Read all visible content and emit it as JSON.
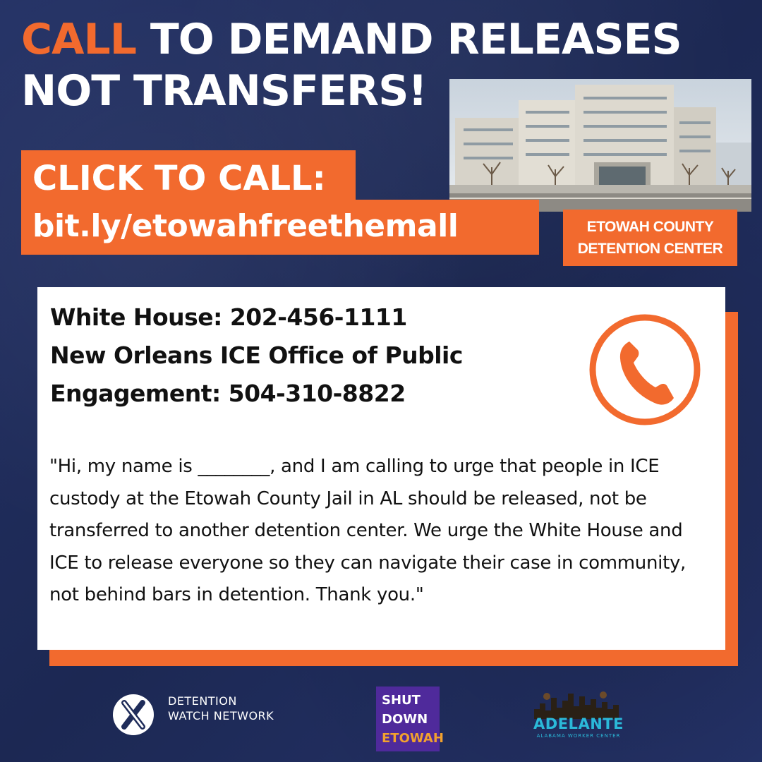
{
  "headline": {
    "line1_accent": "CALL",
    "line1_rest": " TO DEMAND RELEASES",
    "line2": "NOT TRANSFERS!"
  },
  "cta": {
    "label": "CLICK TO CALL:",
    "link": "bit.ly/etowahfreethemall"
  },
  "photo": {
    "caption_line1": "ETOWAH COUNTY",
    "caption_line2": "DETENTION CENTER"
  },
  "contacts": {
    "line1": "White House: 202-456-1111",
    "line2": "New Orleans ICE Office of Public",
    "line3": "Engagement: 504-310-8822",
    "icon": "phone-icon"
  },
  "script": {
    "text": "\"Hi, my name is ________, and I am calling to urge that people in ICE custody at the Etowah County Jail in AL should be released, not be transferred to another detention center. We urge the White House and ICE to release everyone so they can navigate their case in community, not behind bars in detention. Thank you.\""
  },
  "footer": {
    "dwn_line1": "DETENTION",
    "dwn_line2": "WATCH NETWORK",
    "sde_line1": "SHUT",
    "sde_line2": "DOWN",
    "sde_line3": "ETOWAH",
    "adelante_title": "ADELANTE",
    "adelante_sub": "ALABAMA WORKER CENTER"
  },
  "colors": {
    "background": "#1f2c5a",
    "accent": "#f26a2e",
    "card": "#ffffff",
    "sde_purple": "#4f2a9b",
    "adelante_blue": "#2bb9d9"
  }
}
